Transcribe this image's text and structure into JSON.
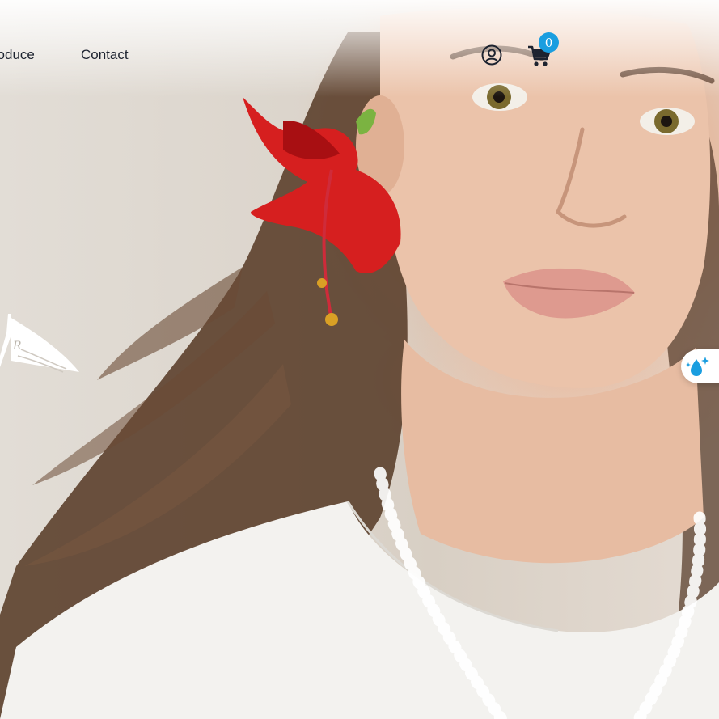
{
  "nav": {
    "items": [
      {
        "label": "Introduce"
      },
      {
        "label": "Contact"
      }
    ]
  },
  "header": {
    "account_icon": "user-circle-icon",
    "cart_icon": "shopping-cart-icon",
    "cart_count": "0",
    "cart_badge_color": "#1a9ee0"
  },
  "hero": {
    "subject": "woman-with-red-hibiscus-flower",
    "logo_icon": "pennant-flag-logo"
  },
  "widget": {
    "icon": "water-drop-sparkle-icon",
    "icon_color": "#1a9ee0"
  }
}
